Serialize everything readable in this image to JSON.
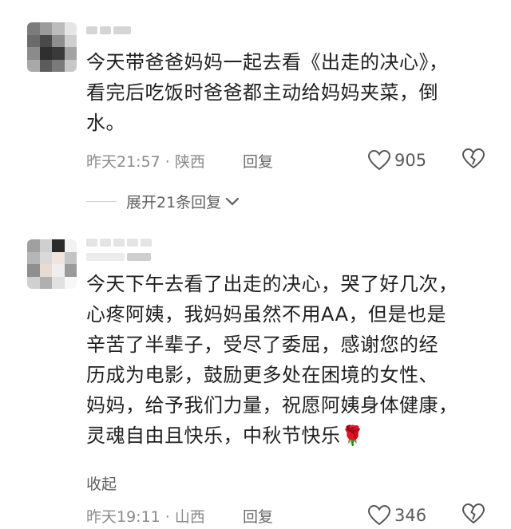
{
  "comments": [
    {
      "text": "今天带爸爸妈妈一起去看《出走的决心》，\n看完后吃饭时爸爸都主动给妈妈夹菜，倒\n水。",
      "time_location": "昨天21:57 · 陕西",
      "reply_label": "回复",
      "like_count": "905",
      "expand_label": "展开21条回复"
    },
    {
      "text": "今天下午去看了出走的决心，哭了好几次，\n心疼阿姨，我妈妈虽然不用AA，但是也是\n辛苦了半辈子，受尽了委屈，感谢您的经\n历成为电影，鼓励更多处在困境的女性、\n妈妈，给予我们力量，祝愿阿姨身体健康，\n灵魂自由且快乐，中秋节快乐",
      "emoji": "🌹",
      "collapse_label": "收起",
      "time_location": "昨天19:11 · 山西",
      "reply_label": "回复",
      "like_count": "346"
    }
  ],
  "colors": {
    "meta_text": "#8a8a8a",
    "body_text": "#1f1f1f",
    "divider": "#cfcfcf"
  },
  "icons": [
    "heart-outline-icon",
    "broken-heart-icon",
    "chevron-down-icon",
    "rose-icon"
  ]
}
